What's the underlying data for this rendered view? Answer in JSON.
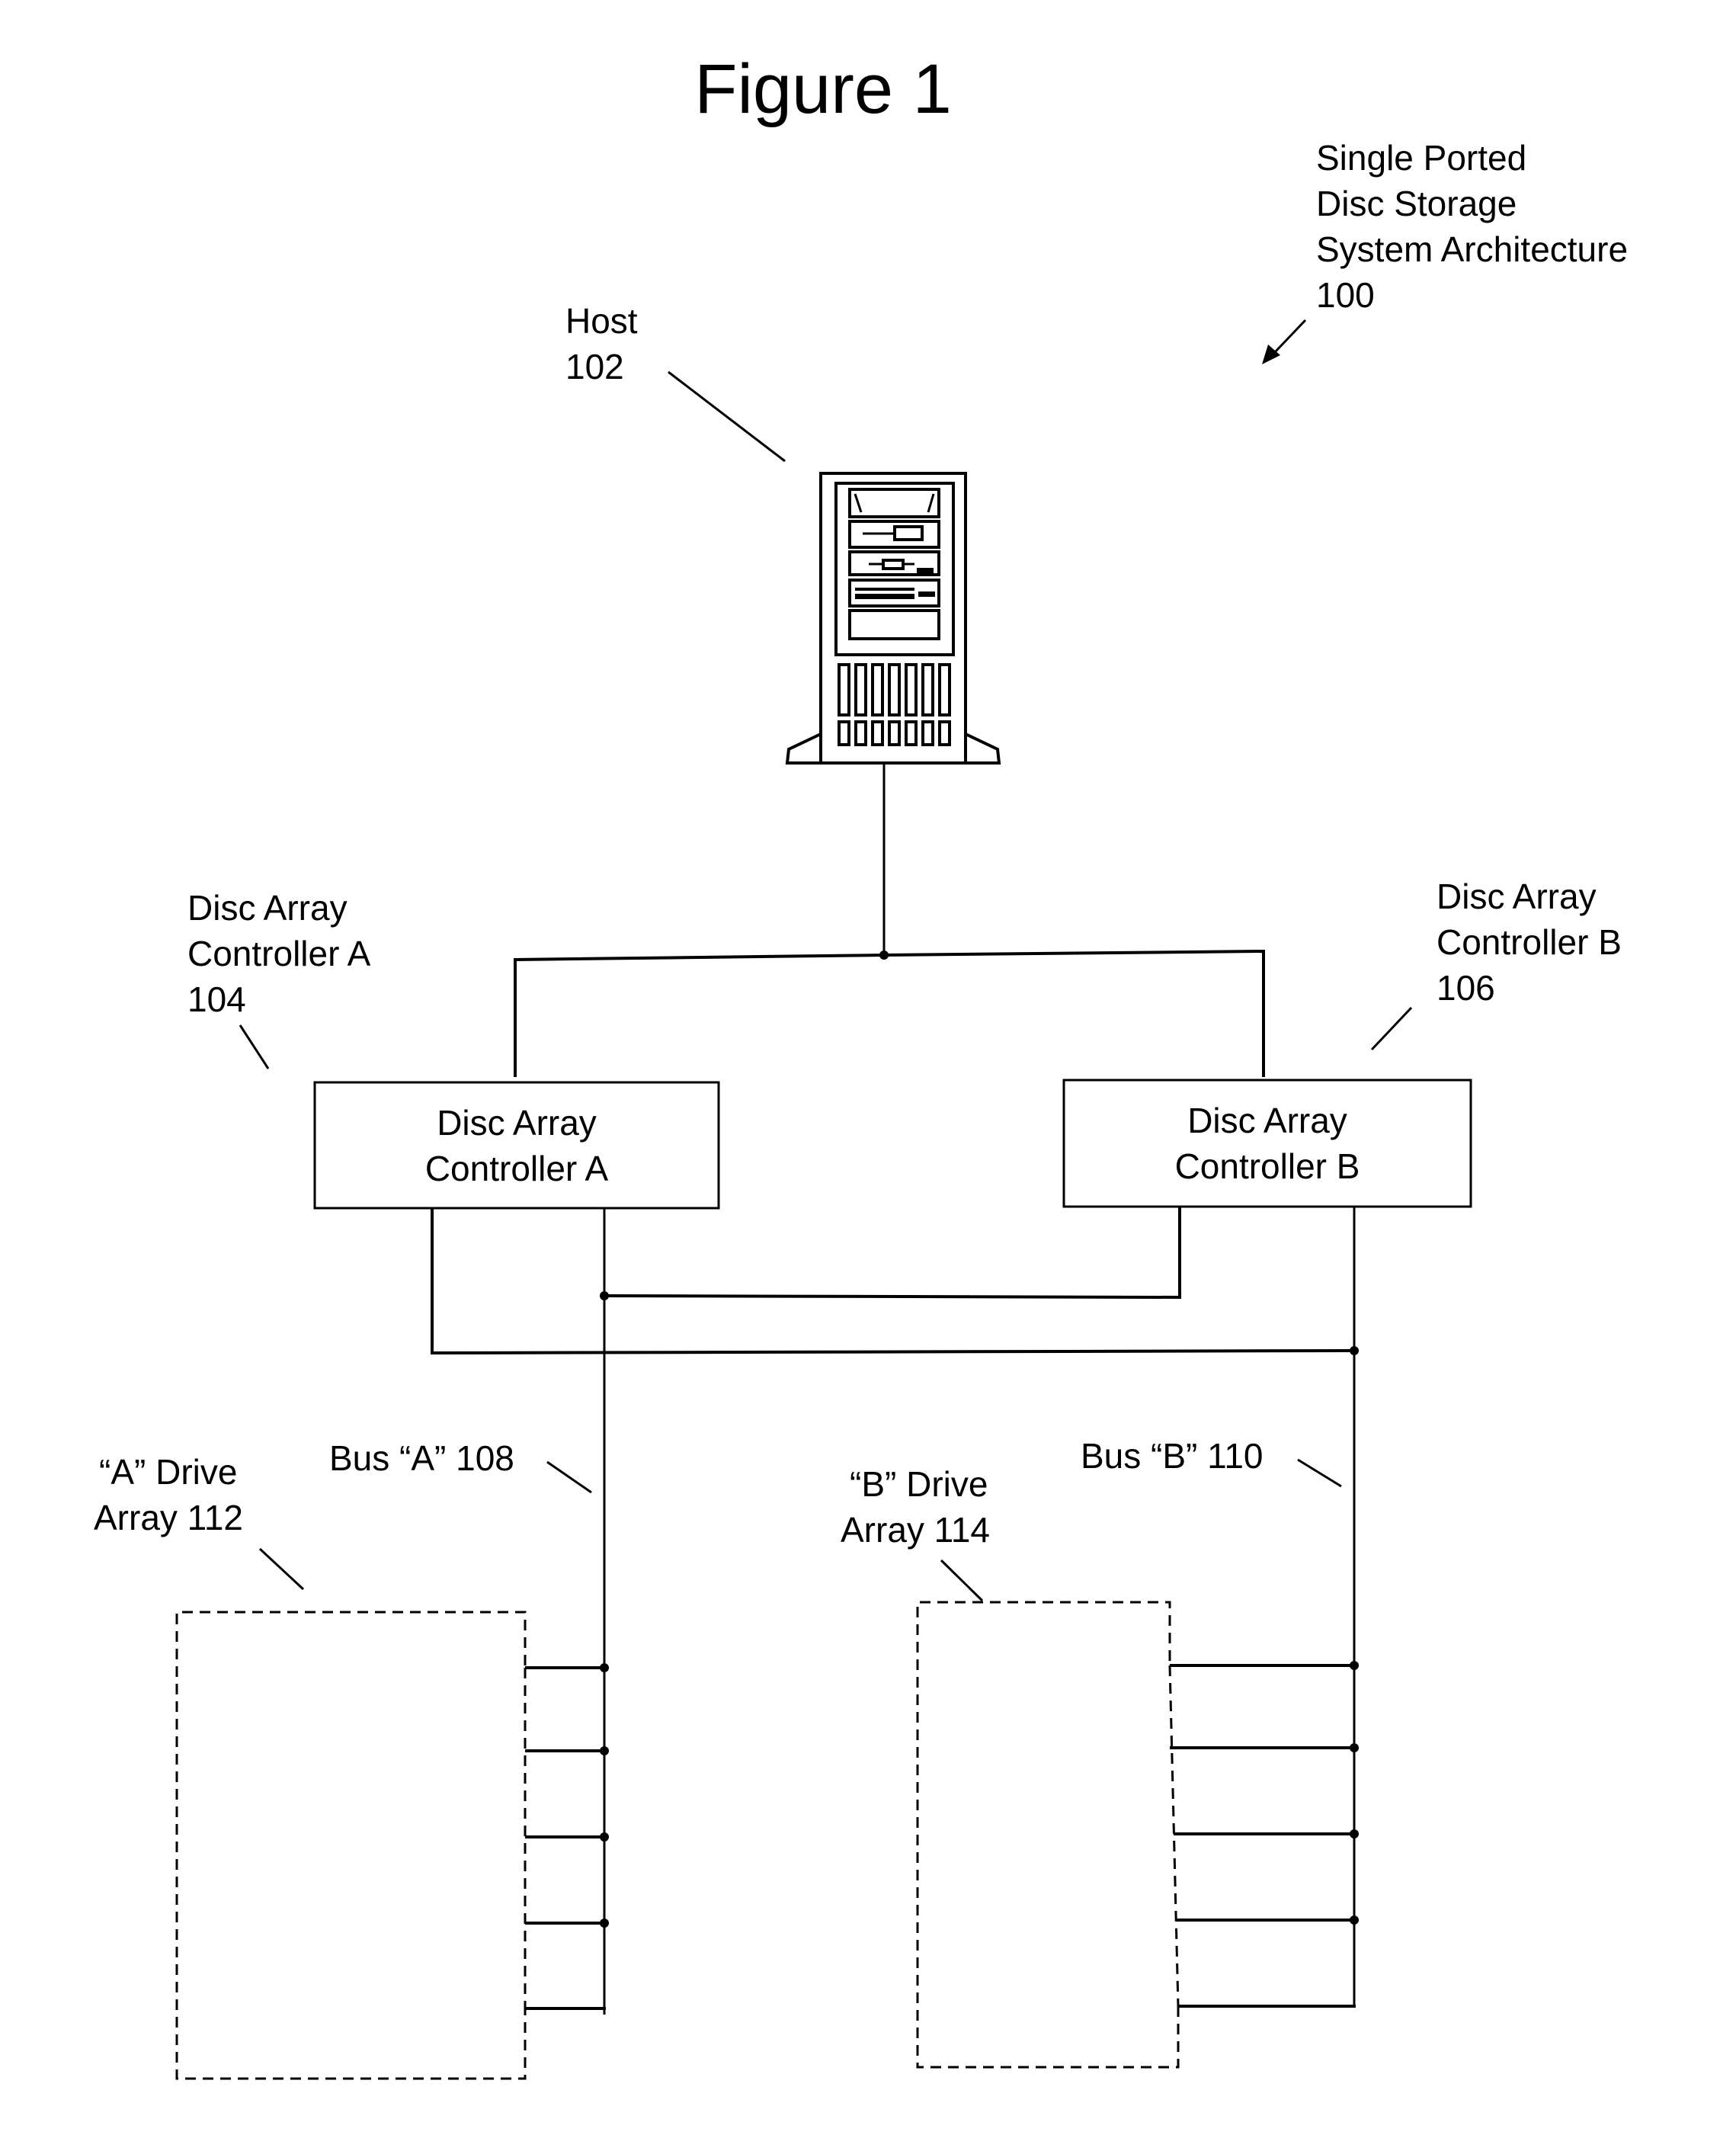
{
  "figure": {
    "title": "Figure 1"
  },
  "system": {
    "label_lines": [
      "Single Ported",
      "Disc Storage",
      "System Architecture",
      "100"
    ]
  },
  "host": {
    "label_lines": [
      "Host",
      "102"
    ],
    "icon": "server-tower-icon"
  },
  "controllers": [
    {
      "callout_lines": [
        "Disc Array",
        "Controller A",
        "104"
      ],
      "box_lines": [
        "Disc Array",
        "Controller A"
      ]
    },
    {
      "callout_lines": [
        "Disc Array",
        "Controller B",
        "106"
      ],
      "box_lines": [
        "Disc Array",
        "Controller B"
      ]
    }
  ],
  "buses": [
    {
      "label": "Bus “A” 108"
    },
    {
      "label": "Bus “B” 110"
    }
  ],
  "drive_arrays": [
    {
      "label_lines": [
        "“A” Drive",
        "Array 112"
      ],
      "drive_count": 5
    },
    {
      "label_lines": [
        "“B” Drive",
        "Array 114"
      ],
      "drive_count": 5
    }
  ]
}
